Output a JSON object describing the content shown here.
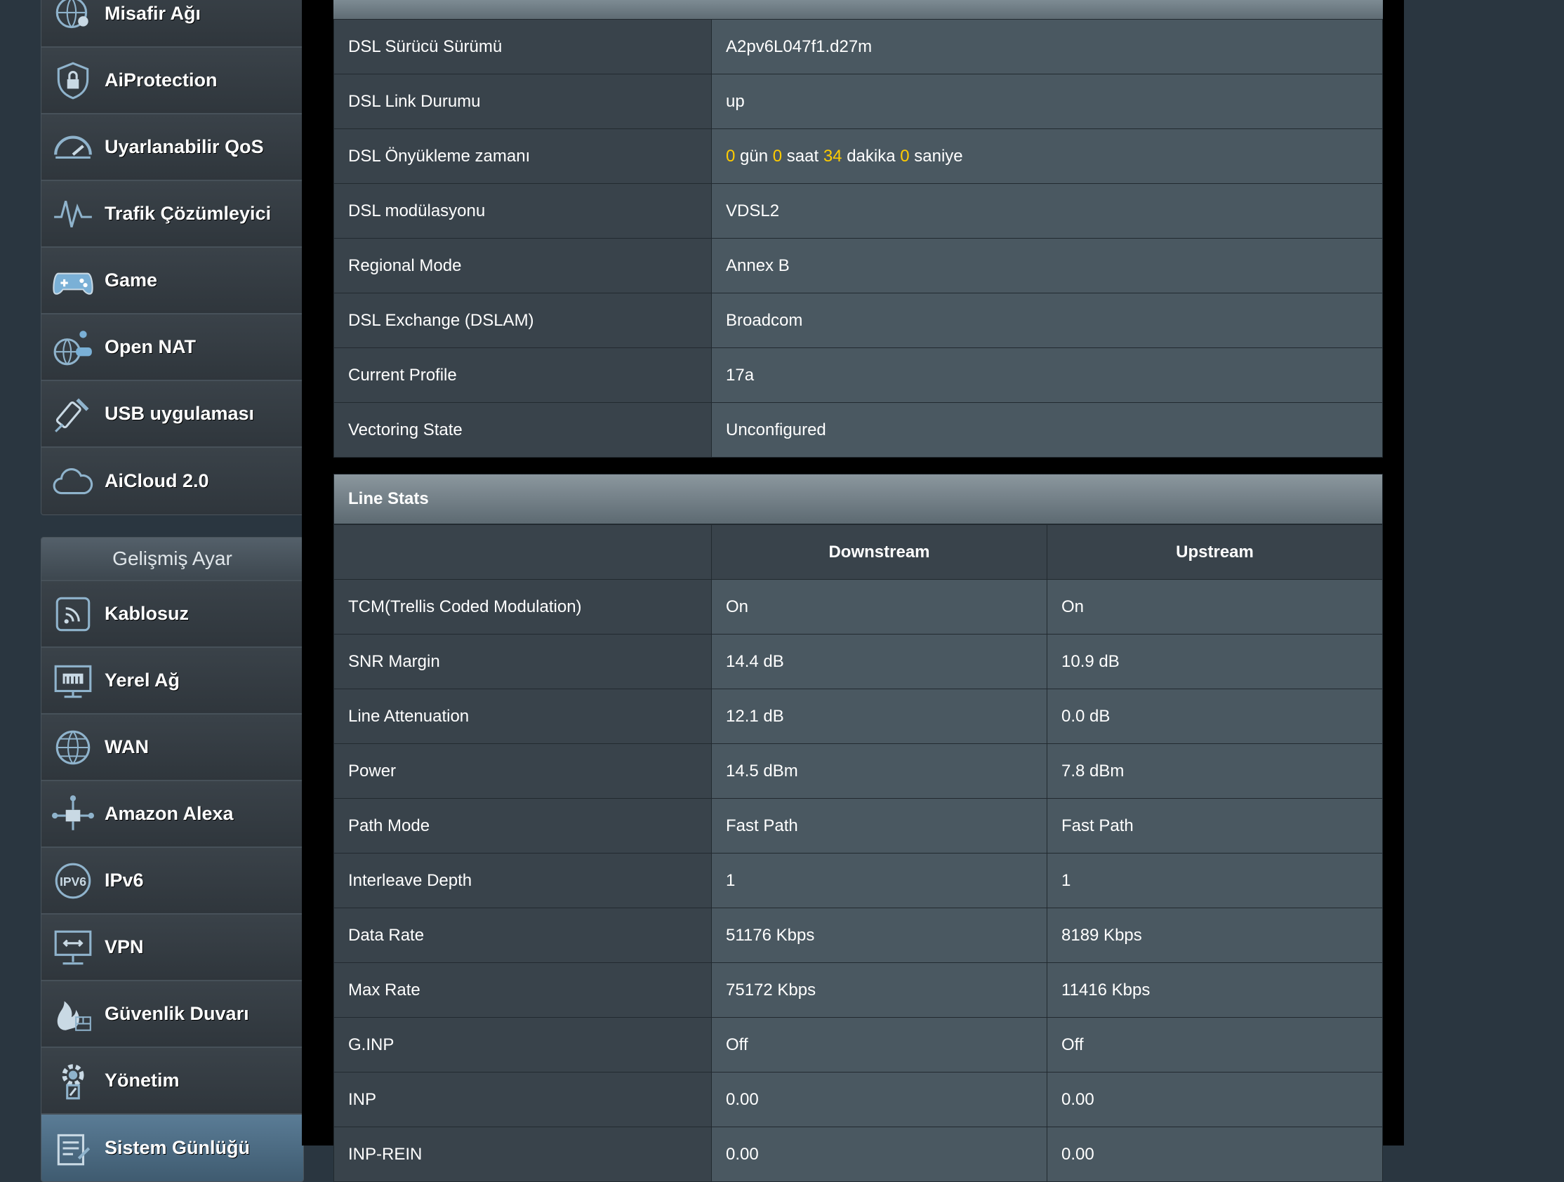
{
  "sidebar": {
    "general_items": [
      {
        "label": "Misafir Ağı",
        "icon": "guest-network-icon"
      },
      {
        "label": "AiProtection",
        "icon": "shield-lock-icon"
      },
      {
        "label": "Uyarlanabilir QoS",
        "icon": "speedometer-icon"
      },
      {
        "label": "Trafik Çözümleyici",
        "icon": "traffic-wave-icon"
      },
      {
        "label": "Game",
        "icon": "gamepad-icon"
      },
      {
        "label": "Open NAT",
        "icon": "globe-gamepad-icon"
      },
      {
        "label": "USB uygulaması",
        "icon": "usb-icon"
      },
      {
        "label": "AiCloud 2.0",
        "icon": "cloud-icon"
      }
    ],
    "advanced_header": "Gelişmiş Ayar",
    "advanced_items": [
      {
        "label": "Kablosuz",
        "icon": "wireless-icon"
      },
      {
        "label": "Yerel Ağ",
        "icon": "lan-icon"
      },
      {
        "label": "WAN",
        "icon": "globe-icon"
      },
      {
        "label": "Amazon Alexa",
        "icon": "alexa-icon"
      },
      {
        "label": "IPv6",
        "icon": "ipv6-icon"
      },
      {
        "label": "VPN",
        "icon": "vpn-icon"
      },
      {
        "label": "Güvenlik Duvarı",
        "icon": "firewall-icon"
      },
      {
        "label": "Yönetim",
        "icon": "admin-gear-icon"
      },
      {
        "label": "Sistem Günlüğü",
        "icon": "system-log-icon"
      }
    ]
  },
  "dsl_info": [
    {
      "label": "DSL Sürücü Sürümü",
      "value": "A2pv6L047f1.d27m"
    },
    {
      "label": "DSL Link Durumu",
      "value": "up"
    },
    {
      "label": "DSL Önyükleme zamanı",
      "value": ""
    },
    {
      "label": "DSL modülasyonu",
      "value": "VDSL2"
    },
    {
      "label": "Regional Mode",
      "value": "Annex B"
    },
    {
      "label": "DSL Exchange (DSLAM)",
      "value": "Broadcom"
    },
    {
      "label": "Current Profile",
      "value": "17a"
    },
    {
      "label": "Vectoring State",
      "value": "Unconfigured"
    }
  ],
  "uptime": {
    "days": "0",
    "days_unit": "gün",
    "hours": "0",
    "hours_unit": "saat",
    "minutes": "34",
    "minutes_unit": "dakika",
    "seconds": "0",
    "seconds_unit": "saniye"
  },
  "line_stats": {
    "title": "Line Stats",
    "col_down": "Downstream",
    "col_up": "Upstream",
    "rows": [
      {
        "label": "TCM(Trellis Coded Modulation)",
        "down": "On",
        "up": "On"
      },
      {
        "label": "SNR Margin",
        "down": "14.4 dB",
        "up": "10.9 dB"
      },
      {
        "label": "Line Attenuation",
        "down": "12.1 dB",
        "up": "0.0 dB"
      },
      {
        "label": "Power",
        "down": "14.5 dBm",
        "up": "7.8 dBm"
      },
      {
        "label": "Path Mode",
        "down": "Fast Path",
        "up": "Fast Path"
      },
      {
        "label": "Interleave Depth",
        "down": "1",
        "up": "1"
      },
      {
        "label": "Data Rate",
        "down": "51176 Kbps",
        "up": "8189 Kbps"
      },
      {
        "label": "Max Rate",
        "down": "75172 Kbps",
        "up": "11416 Kbps"
      },
      {
        "label": "G.INP",
        "down": "Off",
        "up": "Off"
      },
      {
        "label": "INP",
        "down": "0.00",
        "up": "0.00"
      },
      {
        "label": "INP-REIN",
        "down": "0.00",
        "up": "0.00"
      }
    ]
  }
}
